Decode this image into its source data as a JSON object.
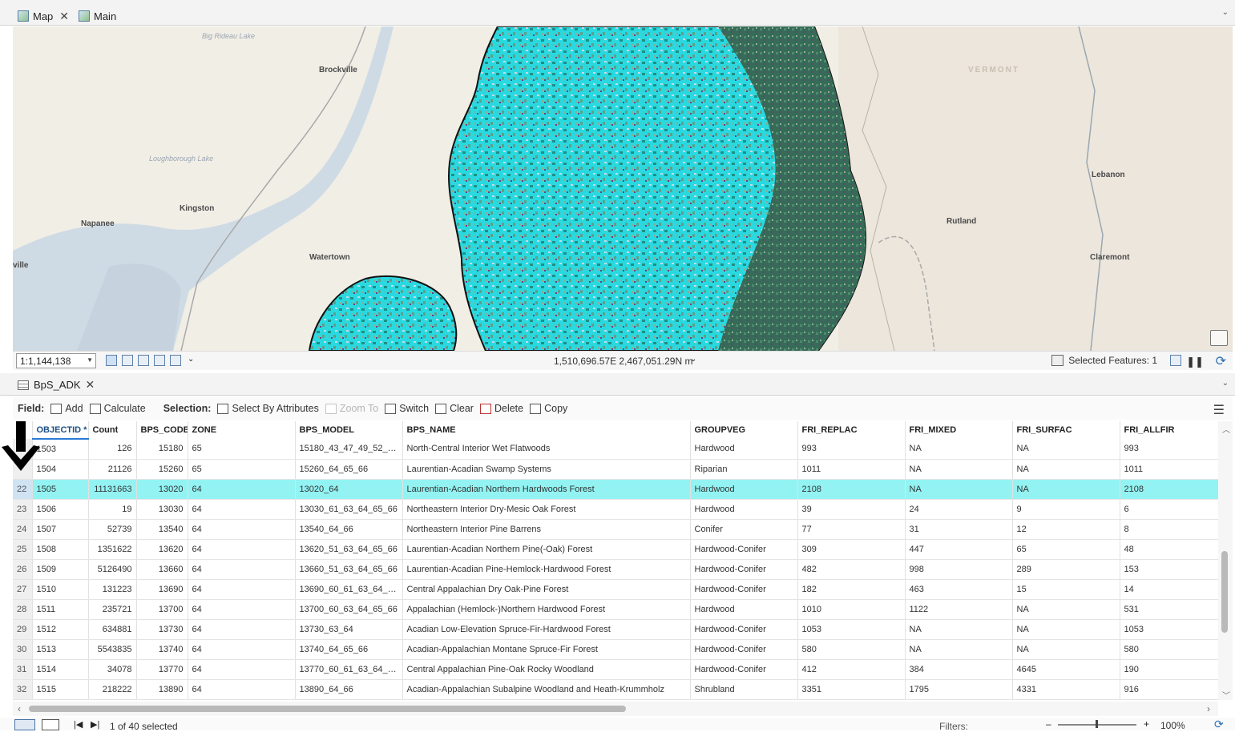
{
  "tabs": [
    {
      "label": "Map",
      "closable": true
    },
    {
      "label": "Main",
      "closable": false
    }
  ],
  "map": {
    "places": [
      {
        "name": "Brockville"
      },
      {
        "name": "Kingston"
      },
      {
        "name": "Napanee"
      },
      {
        "name": "Watertown"
      },
      {
        "name": "ville"
      },
      {
        "name": "Rutland"
      },
      {
        "name": "Lebanon"
      },
      {
        "name": "Claremont"
      },
      {
        "name": "VERMONT"
      }
    ],
    "water_labels": [
      "Big Rideau Lake",
      "Loughborough Lake"
    ]
  },
  "status": {
    "scale": "1:1,144,138",
    "coordinates": "1,510,696.57E 2,467,051.29N m",
    "selected_features": "Selected Features: 1"
  },
  "table_tab": {
    "label": "BpS_ADK"
  },
  "toolbar": {
    "field_label": "Field:",
    "add": "Add",
    "calculate": "Calculate",
    "selection_label": "Selection:",
    "select_by_attributes": "Select By Attributes",
    "zoom_to": "Zoom To",
    "switch": "Switch",
    "clear": "Clear",
    "delete": "Delete",
    "copy": "Copy"
  },
  "table": {
    "columns": [
      "",
      "OBJECTID *",
      "Count",
      "BPS_CODE",
      "ZONE",
      "BPS_MODEL",
      "BPS_NAME",
      "GROUPVEG",
      "FRI_REPLAC",
      "FRI_MIXED",
      "FRI_SURFAC",
      "FRI_ALLFIR"
    ],
    "rows": [
      {
        "n": "",
        "objectid": "1503",
        "count": "126",
        "code": "15180",
        "zone": "65",
        "model": "15180_43_47_49_52_6...",
        "name": "North-Central Interior Wet Flatwoods",
        "groupveg": "Hardwood",
        "replac": "993",
        "mixed": "NA",
        "surfac": "NA",
        "allfir": "993"
      },
      {
        "n": "",
        "objectid": "1504",
        "count": "21126",
        "code": "15260",
        "zone": "65",
        "model": "15260_64_65_66",
        "name": "Laurentian-Acadian Swamp Systems",
        "groupveg": "Riparian",
        "replac": "1011",
        "mixed": "NA",
        "surfac": "NA",
        "allfir": "1011"
      },
      {
        "n": "22",
        "objectid": "1505",
        "count": "11131663",
        "code": "13020",
        "zone": "64",
        "model": "13020_64",
        "name": "Laurentian-Acadian Northern Hardwoods Forest",
        "groupveg": "Hardwood",
        "replac": "2108",
        "mixed": "NA",
        "surfac": "NA",
        "allfir": "2108",
        "selected": true
      },
      {
        "n": "23",
        "objectid": "1506",
        "count": "19",
        "code": "13030",
        "zone": "64",
        "model": "13030_61_63_64_65_66",
        "name": "Northeastern Interior Dry-Mesic Oak Forest",
        "groupveg": "Hardwood",
        "replac": "39",
        "mixed": "24",
        "surfac": "9",
        "allfir": "6"
      },
      {
        "n": "24",
        "objectid": "1507",
        "count": "52739",
        "code": "13540",
        "zone": "64",
        "model": "13540_64_66",
        "name": "Northeastern Interior Pine Barrens",
        "groupveg": "Conifer",
        "replac": "77",
        "mixed": "31",
        "surfac": "12",
        "allfir": "8"
      },
      {
        "n": "25",
        "objectid": "1508",
        "count": "1351622",
        "code": "13620",
        "zone": "64",
        "model": "13620_51_63_64_65_66",
        "name": "Laurentian-Acadian Northern Pine(-Oak) Forest",
        "groupveg": "Hardwood-Conifer",
        "replac": "309",
        "mixed": "447",
        "surfac": "65",
        "allfir": "48"
      },
      {
        "n": "26",
        "objectid": "1509",
        "count": "5126490",
        "code": "13660",
        "zone": "64",
        "model": "13660_51_63_64_65_66",
        "name": "Laurentian-Acadian Pine-Hemlock-Hardwood Forest",
        "groupveg": "Hardwood-Conifer",
        "replac": "482",
        "mixed": "998",
        "surfac": "289",
        "allfir": "153"
      },
      {
        "n": "27",
        "objectid": "1510",
        "count": "131223",
        "code": "13690",
        "zone": "64",
        "model": "13690_60_61_63_64_6...",
        "name": "Central Appalachian Dry Oak-Pine Forest",
        "groupveg": "Hardwood-Conifer",
        "replac": "182",
        "mixed": "463",
        "surfac": "15",
        "allfir": "14"
      },
      {
        "n": "28",
        "objectid": "1511",
        "count": "235721",
        "code": "13700",
        "zone": "64",
        "model": "13700_60_63_64_65_66",
        "name": "Appalachian (Hemlock-)Northern Hardwood Forest",
        "groupveg": "Hardwood",
        "replac": "1010",
        "mixed": "1122",
        "surfac": "NA",
        "allfir": "531"
      },
      {
        "n": "29",
        "objectid": "1512",
        "count": "634881",
        "code": "13730",
        "zone": "64",
        "model": "13730_63_64",
        "name": "Acadian Low-Elevation Spruce-Fir-Hardwood Forest",
        "groupveg": "Hardwood-Conifer",
        "replac": "1053",
        "mixed": "NA",
        "surfac": "NA",
        "allfir": "1053"
      },
      {
        "n": "30",
        "objectid": "1513",
        "count": "5543835",
        "code": "13740",
        "zone": "64",
        "model": "13740_64_65_66",
        "name": "Acadian-Appalachian Montane Spruce-Fir Forest",
        "groupveg": "Hardwood-Conifer",
        "replac": "580",
        "mixed": "NA",
        "surfac": "NA",
        "allfir": "580"
      },
      {
        "n": "31",
        "objectid": "1514",
        "count": "34078",
        "code": "13770",
        "zone": "64",
        "model": "13770_60_61_63_64_6...",
        "name": "Central Appalachian Pine-Oak Rocky Woodland",
        "groupveg": "Hardwood-Conifer",
        "replac": "412",
        "mixed": "384",
        "surfac": "4645",
        "allfir": "190"
      },
      {
        "n": "32",
        "objectid": "1515",
        "count": "218222",
        "code": "13890",
        "zone": "64",
        "model": "13890_64_66",
        "name": "Acadian-Appalachian Subalpine Woodland and Heath-Krummholz",
        "groupveg": "Shrubland",
        "replac": "3351",
        "mixed": "1795",
        "surfac": "4331",
        "allfir": "916"
      }
    ]
  },
  "bottom": {
    "selection": "1 of 40 selected",
    "filters": "Filters:",
    "zoom": "100%"
  },
  "colors": {
    "selected_row": "#93f3f3",
    "raster_cyan": "#29e6ea",
    "raster_green": "#2f6b55",
    "accent": "#2a7bd5"
  }
}
